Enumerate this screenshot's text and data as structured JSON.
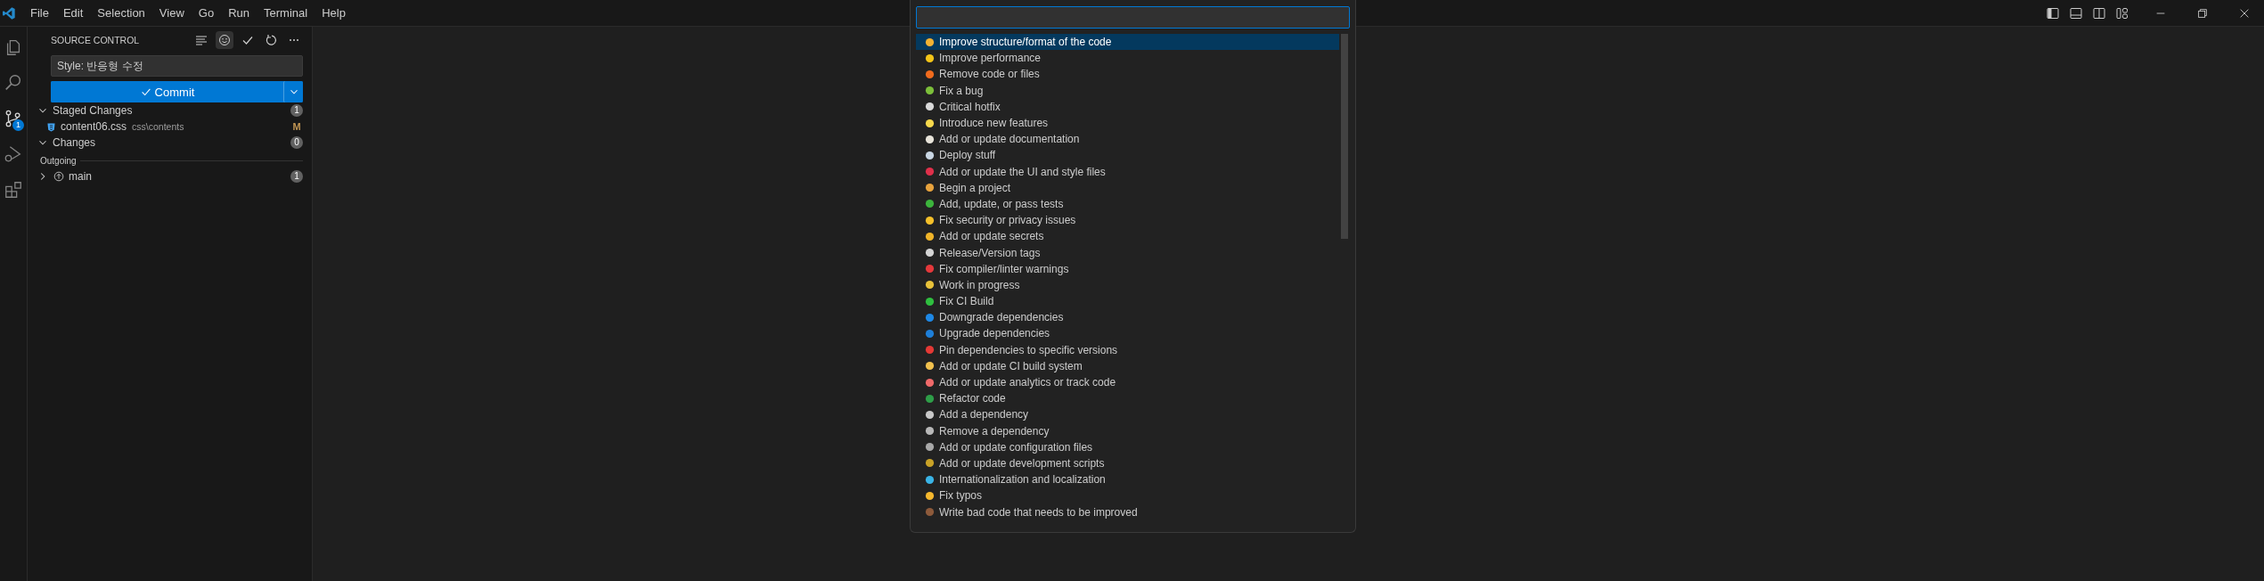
{
  "menu_bar": {
    "items": [
      "File",
      "Edit",
      "Selection",
      "View",
      "Go",
      "Run",
      "Terminal",
      "Help"
    ]
  },
  "activity_bar": {
    "items": [
      {
        "kind": "files",
        "selected": false
      },
      {
        "kind": "search",
        "selected": false
      },
      {
        "kind": "source-control",
        "selected": true,
        "badge": "1"
      },
      {
        "kind": "run",
        "selected": false
      },
      {
        "kind": "extensions",
        "selected": false
      }
    ]
  },
  "sidebar": {
    "title": "SOURCE CONTROL",
    "toolbar": [
      {
        "kind": "lines"
      },
      {
        "kind": "smiley"
      },
      {
        "kind": "check"
      },
      {
        "kind": "refresh"
      },
      {
        "kind": "more"
      }
    ],
    "message": "Style: 반응형 수정",
    "commit_button": "Commit",
    "sections": [
      {
        "label": "Staged Changes",
        "expanded": true,
        "count": "1",
        "files": [
          {
            "name": "content06.css",
            "path": "css\\contents",
            "status": "M"
          }
        ]
      },
      {
        "label": "Changes",
        "expanded": true,
        "count": "0"
      }
    ],
    "outgoing": {
      "label": "Outgoing",
      "branch": "main",
      "expanded": false,
      "count": "1"
    }
  },
  "quick_pick": {
    "items": [
      {
        "label": "Improve structure/format of the code",
        "color": "#f2b233",
        "selected": true
      },
      {
        "label": "Improve performance",
        "color": "#f5c518",
        "selected": false
      },
      {
        "label": "Remove code or files",
        "color": "#f26b1d",
        "selected": false
      },
      {
        "label": "Fix a bug",
        "color": "#7cbf3a",
        "selected": false
      },
      {
        "label": "Critical hotfix",
        "color": "#d9d9d9",
        "selected": false
      },
      {
        "label": "Introduce new features",
        "color": "#f7d94c",
        "selected": false
      },
      {
        "label": "Add or update documentation",
        "color": "#e8e4da",
        "selected": false
      },
      {
        "label": "Deploy stuff",
        "color": "#c9d6e3",
        "selected": false
      },
      {
        "label": "Add or update the UI and style files",
        "color": "#e0304a",
        "selected": false
      },
      {
        "label": "Begin a project",
        "color": "#e8a33d",
        "selected": false
      },
      {
        "label": "Add, update, or pass tests",
        "color": "#3cb43c",
        "selected": false
      },
      {
        "label": "Fix security or privacy issues",
        "color": "#f5c02a",
        "selected": false
      },
      {
        "label": "Add or update secrets",
        "color": "#f0b429",
        "selected": false
      },
      {
        "label": "Release/Version tags",
        "color": "#d4d4d4",
        "selected": false
      },
      {
        "label": "Fix compiler/linter warnings",
        "color": "#e5383b",
        "selected": false
      },
      {
        "label": "Work in progress",
        "color": "#e8c23a",
        "selected": false
      },
      {
        "label": "Fix CI Build",
        "color": "#2fbf3f",
        "selected": false
      },
      {
        "label": "Downgrade dependencies",
        "color": "#1e88e5",
        "selected": false
      },
      {
        "label": "Upgrade dependencies",
        "color": "#1e7fd9",
        "selected": false
      },
      {
        "label": "Pin dependencies to specific versions",
        "color": "#e53935",
        "selected": false
      },
      {
        "label": "Add or update CI build system",
        "color": "#f2c14e",
        "selected": false
      },
      {
        "label": "Add or update analytics or track code",
        "color": "#f06a6a",
        "selected": false
      },
      {
        "label": "Refactor code",
        "color": "#2e9e48",
        "selected": false
      },
      {
        "label": "Add a dependency",
        "color": "#c8c8c8",
        "selected": false
      },
      {
        "label": "Remove a dependency",
        "color": "#b8b8b8",
        "selected": false
      },
      {
        "label": "Add or update configuration files",
        "color": "#a8a8a8",
        "selected": false
      },
      {
        "label": "Add or update development scripts",
        "color": "#c9a227",
        "selected": false
      },
      {
        "label": "Internationalization and localization",
        "color": "#3ab4e6",
        "selected": false
      },
      {
        "label": "Fix typos",
        "color": "#f5b82e",
        "selected": false
      },
      {
        "label": "Write bad code that needs to be improved",
        "color": "#8d5a3b",
        "selected": false
      }
    ]
  }
}
